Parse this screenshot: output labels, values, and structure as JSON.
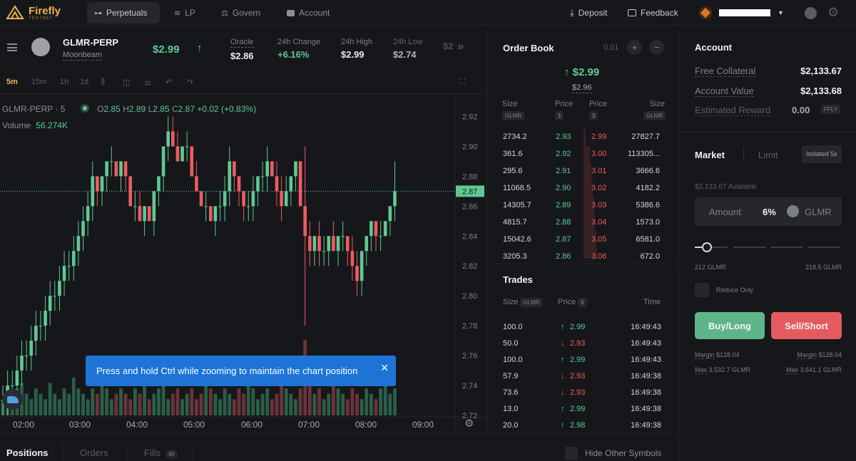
{
  "nav": {
    "logo_text": "Firefly",
    "logo_sub": "TESTNET",
    "items": [
      {
        "label": "Perpetuals",
        "icon": "perpetuals-icon",
        "active": true
      },
      {
        "label": "LP",
        "icon": "layers-icon"
      },
      {
        "label": "Govern",
        "icon": "scales-icon"
      },
      {
        "label": "Account",
        "icon": "wallet-icon"
      }
    ],
    "deposit_label": "Deposit",
    "feedback_label": "Feedback"
  },
  "market": {
    "symbol": "GLMR-PERP",
    "name": "Moonbeam",
    "price": "$2.99",
    "stats": [
      {
        "label": "Oracle",
        "value": "$2.86"
      },
      {
        "label": "24h Change",
        "value": "+6.16%"
      },
      {
        "label": "24h High",
        "value": "$2.99"
      },
      {
        "label": "24h Low",
        "value": "$2.74"
      },
      {
        "label": "",
        "value": "$2."
      }
    ]
  },
  "chart_tools": {
    "timeframes": [
      "5m",
      "15m",
      "1h",
      "1d"
    ],
    "active_timeframe": "5m"
  },
  "chart": {
    "legend_symbol": "GLMR-PERP · 5",
    "ohlc": {
      "o_label": "O",
      "o": "2.85",
      "h_label": "H",
      "h": "2.89",
      "l_label": "L",
      "l": "2.85",
      "c_label": "C",
      "c": "2.87",
      "change": "+0.02 (+0.83%)"
    },
    "volume_label": "Volume",
    "volume_value": "56.274K",
    "last_price": "2.87",
    "toast": "Press and hold Ctrl while zooming to maintain the chart position"
  },
  "chart_data": {
    "type": "candlestick",
    "ylim": [
      2.72,
      2.925
    ],
    "y_ticks": [
      "2.92",
      "2.90",
      "2.88",
      "2.87",
      "2.86",
      "2.84",
      "2.82",
      "2.80",
      "2.78",
      "2.76",
      "2.74",
      "2.72"
    ],
    "x_ticks": [
      "02:00",
      "03:00",
      "04:00",
      "05:00",
      "06:00",
      "07:00",
      "08:00",
      "09:00"
    ],
    "candles": [
      [
        2.73,
        2.74,
        2.72,
        2.73
      ],
      [
        2.73,
        2.75,
        2.72,
        2.74
      ],
      [
        2.74,
        2.75,
        2.73,
        2.74
      ],
      [
        2.74,
        2.76,
        2.73,
        2.75
      ],
      [
        2.75,
        2.77,
        2.74,
        2.76
      ],
      [
        2.76,
        2.77,
        2.75,
        2.76
      ],
      [
        2.76,
        2.78,
        2.75,
        2.77
      ],
      [
        2.77,
        2.79,
        2.76,
        2.78
      ],
      [
        2.78,
        2.79,
        2.77,
        2.78
      ],
      [
        2.78,
        2.8,
        2.77,
        2.79
      ],
      [
        2.79,
        2.81,
        2.78,
        2.8
      ],
      [
        2.8,
        2.81,
        2.79,
        2.8
      ],
      [
        2.8,
        2.82,
        2.79,
        2.81
      ],
      [
        2.81,
        2.83,
        2.8,
        2.82
      ],
      [
        2.82,
        2.83,
        2.81,
        2.82
      ],
      [
        2.82,
        2.84,
        2.81,
        2.83
      ],
      [
        2.83,
        2.85,
        2.82,
        2.84
      ],
      [
        2.84,
        2.86,
        2.83,
        2.85
      ],
      [
        2.85,
        2.87,
        2.84,
        2.86
      ],
      [
        2.86,
        2.89,
        2.85,
        2.88
      ],
      [
        2.88,
        2.88,
        2.86,
        2.87
      ],
      [
        2.87,
        2.88,
        2.86,
        2.88
      ],
      [
        2.88,
        2.89,
        2.87,
        2.89
      ],
      [
        2.89,
        2.9,
        2.88,
        2.89
      ],
      [
        2.89,
        2.89,
        2.88,
        2.88
      ],
      [
        2.88,
        2.89,
        2.87,
        2.89
      ],
      [
        2.89,
        2.89,
        2.87,
        2.88
      ],
      [
        2.88,
        2.88,
        2.86,
        2.86
      ],
      [
        2.86,
        2.87,
        2.85,
        2.86
      ],
      [
        2.86,
        2.87,
        2.85,
        2.85
      ],
      [
        2.85,
        2.86,
        2.84,
        2.86
      ],
      [
        2.86,
        2.86,
        2.85,
        2.85
      ],
      [
        2.85,
        2.87,
        2.84,
        2.87
      ],
      [
        2.87,
        2.88,
        2.86,
        2.88
      ],
      [
        2.88,
        2.9,
        2.87,
        2.9
      ],
      [
        2.9,
        2.92,
        2.89,
        2.91
      ],
      [
        2.91,
        2.92,
        2.9,
        2.9
      ],
      [
        2.9,
        2.91,
        2.89,
        2.89
      ],
      [
        2.89,
        2.9,
        2.89,
        2.9
      ],
      [
        2.9,
        2.91,
        2.89,
        2.9
      ],
      [
        2.9,
        2.9,
        2.88,
        2.88
      ],
      [
        2.88,
        2.89,
        2.87,
        2.87
      ],
      [
        2.87,
        2.87,
        2.86,
        2.86
      ],
      [
        2.86,
        2.87,
        2.85,
        2.86
      ],
      [
        2.86,
        2.86,
        2.85,
        2.85
      ],
      [
        2.85,
        2.86,
        2.84,
        2.86
      ],
      [
        2.86,
        2.87,
        2.85,
        2.86
      ],
      [
        2.86,
        2.88,
        2.85,
        2.87
      ],
      [
        2.87,
        2.9,
        2.86,
        2.89
      ],
      [
        2.89,
        2.89,
        2.87,
        2.88
      ],
      [
        2.88,
        2.88,
        2.86,
        2.87
      ],
      [
        2.87,
        2.87,
        2.85,
        2.86
      ],
      [
        2.86,
        2.87,
        2.85,
        2.86
      ],
      [
        2.86,
        2.88,
        2.85,
        2.87
      ],
      [
        2.87,
        2.88,
        2.86,
        2.88
      ],
      [
        2.88,
        2.89,
        2.87,
        2.88
      ],
      [
        2.88,
        2.9,
        2.87,
        2.89
      ],
      [
        2.89,
        2.89,
        2.88,
        2.88
      ],
      [
        2.88,
        2.89,
        2.86,
        2.87
      ],
      [
        2.87,
        2.88,
        2.85,
        2.86
      ],
      [
        2.86,
        2.88,
        2.86,
        2.87
      ],
      [
        2.87,
        2.88,
        2.86,
        2.88
      ],
      [
        2.88,
        2.89,
        2.87,
        2.89
      ],
      [
        2.89,
        2.89,
        2.86,
        2.86
      ],
      [
        2.86,
        2.9,
        2.78,
        2.84
      ],
      [
        2.84,
        2.85,
        2.82,
        2.83
      ],
      [
        2.83,
        2.84,
        2.82,
        2.84
      ],
      [
        2.84,
        2.85,
        2.82,
        2.83
      ],
      [
        2.83,
        2.84,
        2.82,
        2.83
      ],
      [
        2.83,
        2.84,
        2.82,
        2.84
      ],
      [
        2.84,
        2.85,
        2.83,
        2.83
      ],
      [
        2.83,
        2.84,
        2.82,
        2.84
      ],
      [
        2.84,
        2.85,
        2.83,
        2.84
      ],
      [
        2.84,
        2.84,
        2.82,
        2.83
      ],
      [
        2.83,
        2.84,
        2.81,
        2.82
      ],
      [
        2.82,
        2.83,
        2.8,
        2.81
      ],
      [
        2.81,
        2.83,
        2.8,
        2.83
      ],
      [
        2.83,
        2.84,
        2.82,
        2.84
      ],
      [
        2.84,
        2.85,
        2.83,
        2.85
      ],
      [
        2.85,
        2.85,
        2.83,
        2.84
      ],
      [
        2.84,
        2.85,
        2.83,
        2.84
      ],
      [
        2.84,
        2.85,
        2.84,
        2.85
      ],
      [
        2.85,
        2.86,
        2.84,
        2.86
      ],
      [
        2.86,
        2.89,
        2.85,
        2.87
      ]
    ],
    "volumes": [
      3,
      4,
      3,
      5,
      6,
      4,
      3,
      5,
      4,
      3,
      6,
      4,
      3,
      5,
      4,
      7,
      5,
      4,
      3,
      5,
      4,
      6,
      5,
      3,
      4,
      5,
      4,
      3,
      5,
      4,
      6,
      3,
      4,
      5,
      6,
      3,
      4,
      5,
      3,
      4,
      5,
      3,
      4,
      6,
      5,
      4,
      3,
      5,
      4,
      3,
      5,
      4,
      6,
      5,
      3,
      4,
      5,
      3,
      4,
      6,
      5,
      4,
      3,
      5,
      14,
      6,
      4,
      5,
      3,
      4,
      6,
      5,
      4,
      3,
      5,
      4,
      3,
      5,
      4,
      3,
      5,
      6,
      4,
      5
    ]
  },
  "orderbook": {
    "title": "Order Book",
    "tick": "0.01",
    "mid_price": "$2.99",
    "mark_price": "$2.96",
    "col_size": "Size",
    "col_price": "Price",
    "unit_glmr": "GLMR",
    "unit_usd": "$",
    "rows": [
      {
        "bid_size": "2734.2",
        "bid_price": "2.93",
        "ask_price": "2.99",
        "ask_size": "27827.7",
        "depth": 0.05
      },
      {
        "bid_size": "361.6",
        "bid_price": "2.92",
        "ask_price": "3.00",
        "ask_size": "113305...",
        "depth": 0.18
      },
      {
        "bid_size": "295.6",
        "bid_price": "2.91",
        "ask_price": "3.01",
        "ask_size": "3666.6",
        "depth": 0.22
      },
      {
        "bid_size": "11068.5",
        "bid_price": "2.90",
        "ask_price": "3.02",
        "ask_size": "4182.2",
        "depth": 0.26
      },
      {
        "bid_size": "14305.7",
        "bid_price": "2.89",
        "ask_price": "3.03",
        "ask_size": "5386.6",
        "depth": 0.3
      },
      {
        "bid_size": "4815.7",
        "bid_price": "2.88",
        "ask_price": "3.04",
        "ask_size": "1573.0",
        "depth": 0.32
      },
      {
        "bid_size": "15042.6",
        "bid_price": "2.87",
        "ask_price": "3.05",
        "ask_size": "6581.0",
        "depth": 0.36
      },
      {
        "bid_size": "3205.3",
        "bid_price": "2.86",
        "ask_price": "3.06",
        "ask_size": "672.0",
        "depth": 0.38
      }
    ]
  },
  "trades": {
    "title": "Trades",
    "col_size": "Size",
    "col_price": "Price",
    "col_time": "Time",
    "unit_glmr": "GLMR",
    "unit_usd": "$",
    "rows": [
      {
        "size": "100.0",
        "price": "2.99",
        "side": "up",
        "time": "16:49:43"
      },
      {
        "size": "50.0",
        "price": "2.93",
        "side": "down",
        "time": "16:49:43"
      },
      {
        "size": "100.0",
        "price": "2.99",
        "side": "up",
        "time": "16:49:43"
      },
      {
        "size": "57.9",
        "price": "2.93",
        "side": "down",
        "time": "16:49:38"
      },
      {
        "size": "73.6",
        "price": "2.93",
        "side": "down",
        "time": "16:49:38"
      },
      {
        "size": "13.0",
        "price": "2.99",
        "side": "up",
        "time": "16:49:38"
      },
      {
        "size": "20.0",
        "price": "2.98",
        "side": "up",
        "time": "16:49:38"
      }
    ]
  },
  "account": {
    "title": "Account",
    "rows": [
      {
        "label": "Free Collateral",
        "value": "$2,133.67"
      },
      {
        "label": "Account Value",
        "value": "$2,133.68"
      },
      {
        "label": "Estimated Reward",
        "value": "0.00",
        "unit": "FFLY"
      }
    ],
    "tab_market": "Market",
    "tab_limit": "Limit",
    "leverage_badge": "Isolated 5x",
    "available": "$2,133.67 Available",
    "amount_placeholder": "Amount",
    "amount_pct": "6%",
    "amount_unit": "GLMR",
    "slider_value": 0.06,
    "slider_min": "212 GLMR",
    "slider_max": "218.5 GLMR",
    "reduce_only": "Reduce Only",
    "buy_label": "Buy/Long",
    "sell_label": "Sell/Short",
    "margin_label": "Margin",
    "buy_margin": "$128.04",
    "sell_margin": "$128.04",
    "max_label": "Max",
    "buy_max": "3,532.7 GLMR",
    "sell_max": "3,641.1 GLMR"
  },
  "bottom": {
    "tabs": [
      "Positions",
      "Orders",
      "Fills"
    ],
    "fills_count": "46",
    "hide_other": "Hide Other Symbols"
  },
  "colors": {
    "bg": "#16171b",
    "green": "#5fc994",
    "red": "#ef5b62",
    "accent_blue": "#1d74d6",
    "buy": "#5fb58a",
    "sell": "#e55a5f"
  }
}
